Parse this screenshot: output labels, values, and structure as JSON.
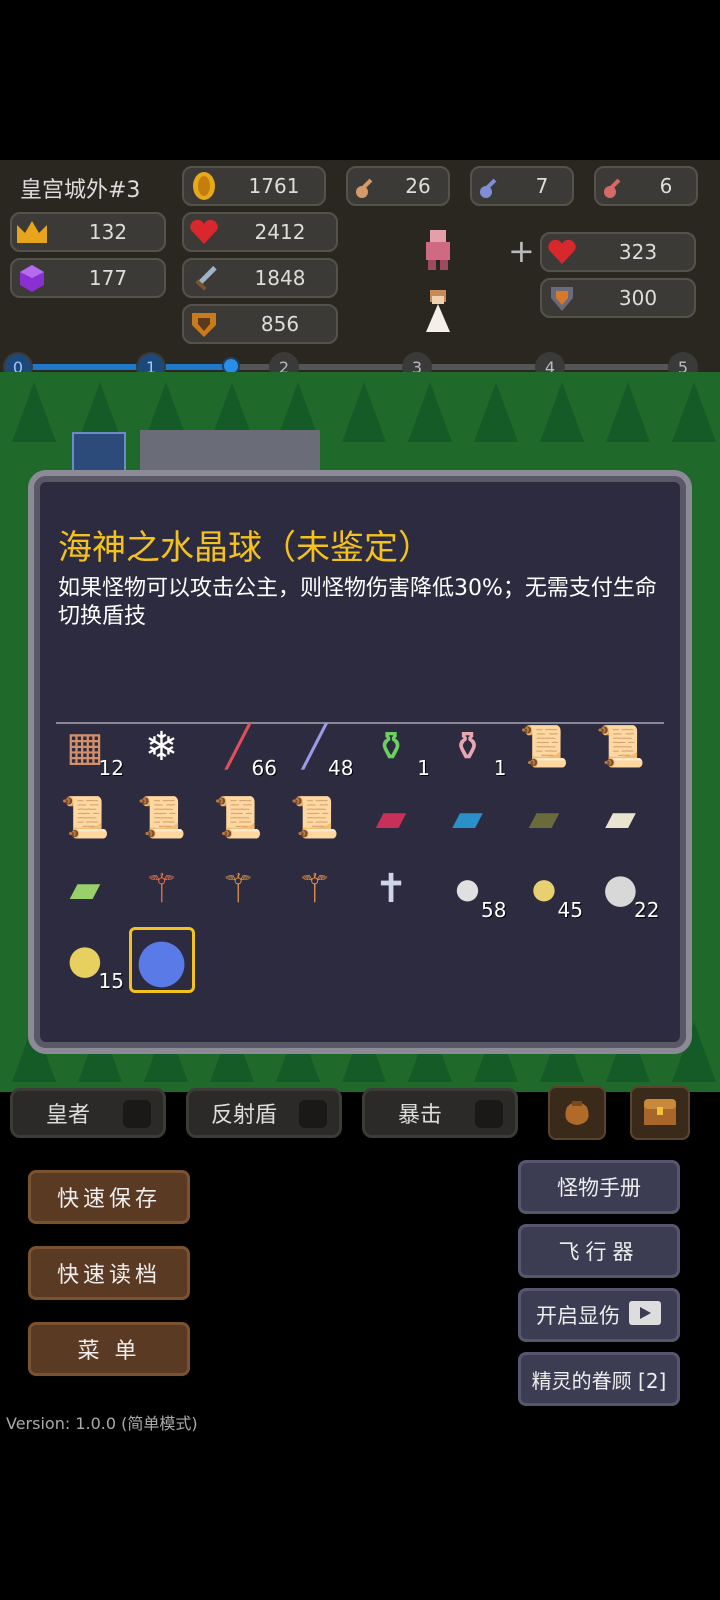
{
  "hud": {
    "floor": "皇宫城外#3",
    "gold": "1761",
    "key_bronze": "26",
    "key_blue": "7",
    "key_red": "6",
    "level": "132",
    "hp": "2412",
    "gem": "177",
    "attack": "1848",
    "defense": "856",
    "plus": "+",
    "princess_hp": "323",
    "princess_def": "300"
  },
  "progress": {
    "nodes": [
      "0",
      "1",
      "2",
      "3",
      "4",
      "5"
    ],
    "current": 1.6
  },
  "item_panel": {
    "title": "海神之水晶球（未鉴定）",
    "description": "如果怪物可以攻击公主，则怪物伤害降低30%；无需支付生命切换盾技",
    "items": [
      {
        "icon": "ancient-tablet-icon",
        "count": "12"
      },
      {
        "icon": "snowflake-crystal-icon",
        "count": ""
      },
      {
        "icon": "red-potion-icon",
        "count": "66"
      },
      {
        "icon": "blue-potion-icon",
        "count": "48"
      },
      {
        "icon": "green-flask-icon",
        "count": "1"
      },
      {
        "icon": "pink-flask-icon",
        "count": "1"
      },
      {
        "icon": "scroll-blue-icon",
        "count": ""
      },
      {
        "icon": "scroll-tan-icon",
        "count": ""
      },
      {
        "icon": "scroll-green-icon",
        "count": ""
      },
      {
        "icon": "scroll-purple-icon",
        "count": ""
      },
      {
        "icon": "scroll-pink-icon",
        "count": ""
      },
      {
        "icon": "scroll-gray-icon",
        "count": ""
      },
      {
        "icon": "red-book-icon",
        "count": ""
      },
      {
        "icon": "blue-book-icon",
        "count": ""
      },
      {
        "icon": "olive-book-icon",
        "count": ""
      },
      {
        "icon": "white-book-icon",
        "count": ""
      },
      {
        "icon": "green-book-icon",
        "count": ""
      },
      {
        "icon": "red-staff-icon",
        "count": ""
      },
      {
        "icon": "green-staff-icon",
        "count": ""
      },
      {
        "icon": "blue-staff-icon",
        "count": ""
      },
      {
        "icon": "silver-cross-icon",
        "count": ""
      },
      {
        "icon": "silver-coin-small-icon",
        "count": "58"
      },
      {
        "icon": "gold-coin-small-icon",
        "count": "45"
      },
      {
        "icon": "silver-coin-large-icon",
        "count": "22"
      },
      {
        "icon": "gold-coin-large-icon",
        "count": "15"
      },
      {
        "icon": "crystal-ball-icon",
        "count": "",
        "selected": true
      }
    ]
  },
  "skills": {
    "skill1": "皇者",
    "skill2": "反射盾",
    "skill3": "暴击"
  },
  "buttons": {
    "quick_save": "快速保存",
    "quick_load": "快速读档",
    "menu": "菜 单",
    "monster_book": "怪物手册",
    "flyer": "飞行器",
    "show_damage": "开启显伤",
    "fairy_favor": "精灵的眷顾 [2]"
  },
  "version": "Version: 1.0.0 (简单模式)",
  "colors": {
    "accent_gold": "#f3c21e",
    "panel_bg": "#2d2b3f",
    "grass": "#1f6a2a",
    "progress_blue": "#1f78c8"
  }
}
